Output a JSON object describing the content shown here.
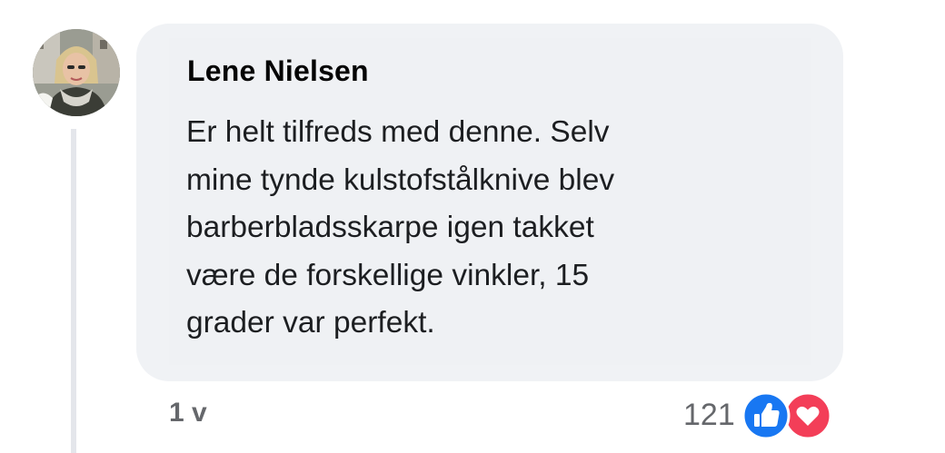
{
  "comment": {
    "author": "Lene Nielsen",
    "text_lines": [
      "Er helt tilfreds med denne. Selv",
      "mine tynde kulstofstålknive blev",
      "barberbladsskarpe igen takket",
      "være de forskellige vinkler, 15",
      "grader var perfekt."
    ],
    "timestamp": "1 v",
    "reaction_count": "121",
    "reactions": [
      "like-icon",
      "love-icon"
    ]
  },
  "colors": {
    "bubble": "#f0f2f5",
    "text": "#1c1e21",
    "meta": "#65676b",
    "like": "#1877f2",
    "love": "#f33e58",
    "thread_line": "#e4e6eb"
  }
}
